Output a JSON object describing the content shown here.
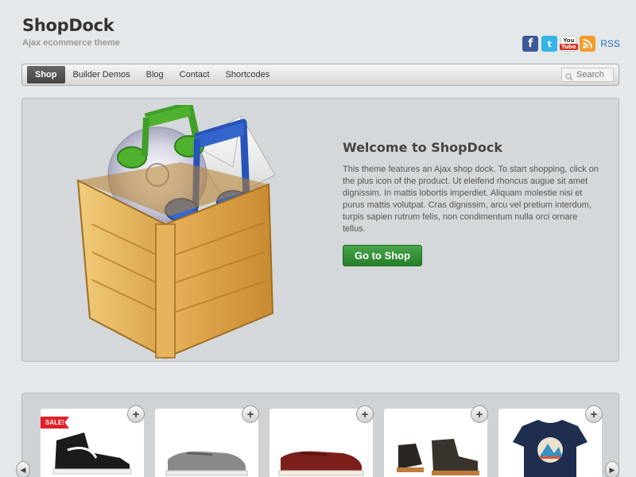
{
  "site": {
    "title": "ShopDock",
    "tagline": "Ajax ecommerce theme"
  },
  "social": {
    "icons": [
      "facebook-icon",
      "twitter-icon",
      "youtube-icon",
      "rss-icon"
    ],
    "facebook_glyph": "f",
    "twitter_glyph": "t",
    "youtube_top": "You",
    "youtube_bottom": "Tube",
    "rss_label": "RSS"
  },
  "nav": {
    "items": [
      {
        "label": "Shop",
        "active": true
      },
      {
        "label": "Builder Demos",
        "active": false
      },
      {
        "label": "Blog",
        "active": false
      },
      {
        "label": "Contact",
        "active": false
      },
      {
        "label": "Shortcodes",
        "active": false
      }
    ],
    "search_placeholder": "Search"
  },
  "hero": {
    "title": "Welcome to ShopDock",
    "text": "This theme features an Ajax shop dock. To start shopping, click on the plus icon of the product. Ut eleifend rhoncus augue sit amet dignissim. In mattis lobortis imperdiet. Aliquam molestie nisi et purus mattis volutpat. Cras dignissim, arcu vel pretium interdum, turpis sapien rutrum felis, non condimentum nulla orci ornare tellus.",
    "button_label": "Go to Shop"
  },
  "products": {
    "items": [
      {
        "image": "high-top-sneaker",
        "sale": true
      },
      {
        "image": "grey-low-sneaker",
        "sale": false
      },
      {
        "image": "red-low-sneaker",
        "sale": false
      },
      {
        "image": "brown-chukka-boot",
        "sale": false
      },
      {
        "image": "navy-australia-tshirt",
        "sale": false
      }
    ],
    "sale_label": "SALE!",
    "add_glyph": "+",
    "prev_glyph": "◀",
    "next_glyph": "▶"
  },
  "colors": {
    "background": "#e4e8ea",
    "button_green": "#2e8a31",
    "nav_active": "#555555",
    "sale_red": "#e0202a",
    "link_blue": "#2a6fb5"
  }
}
